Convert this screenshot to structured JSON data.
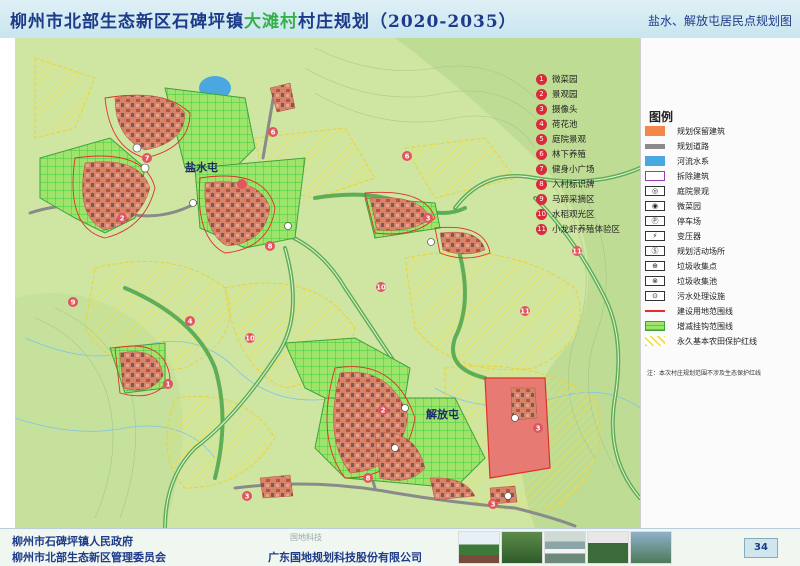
{
  "header": {
    "title_part1": "柳州市北部生态新区石碑坪镇",
    "title_highlight": "大滩村",
    "title_part2": "村庄规划（2020-2035）",
    "subtitle": "盐水、解放屯居民点规划图"
  },
  "map": {
    "north_label": "N",
    "village_labels": {
      "yanshui": "盐水屯",
      "jiefang": "解放屯"
    },
    "zone_markers": [
      "1",
      "2",
      "3",
      "4",
      "5",
      "6",
      "7",
      "8",
      "9",
      "10",
      "11"
    ],
    "numbered_items": [
      {
        "n": "1",
        "label": "微菜园"
      },
      {
        "n": "2",
        "label": "景观园"
      },
      {
        "n": "3",
        "label": "摄像头"
      },
      {
        "n": "4",
        "label": "荷花池"
      },
      {
        "n": "5",
        "label": "庭院景观"
      },
      {
        "n": "6",
        "label": "林下养殖"
      },
      {
        "n": "7",
        "label": "健身小广场"
      },
      {
        "n": "8",
        "label": "入村标识牌"
      },
      {
        "n": "9",
        "label": "马蹄采摘区"
      },
      {
        "n": "10",
        "label": "水稻观光区"
      },
      {
        "n": "11",
        "label": "小龙虾养殖体验区"
      }
    ]
  },
  "legend": {
    "title": "图例",
    "items": [
      {
        "label": "规划保留建筑",
        "icon": "orange-fill",
        "color": "#f2874a"
      },
      {
        "label": "规划道路",
        "icon": "gray-bar",
        "color": "#8a8a8a"
      },
      {
        "label": "河流水系",
        "icon": "blue-fill",
        "color": "#4aa7e0"
      },
      {
        "label": "拆除建筑",
        "icon": "purple-outline",
        "color": "#9b3bb0"
      },
      {
        "label": "庭院景观",
        "icon": "circle-symbol"
      },
      {
        "label": "微菜园",
        "icon": "circle-symbol"
      },
      {
        "label": "停车场",
        "icon": "parking-symbol"
      },
      {
        "label": "变压器",
        "icon": "lightning-symbol"
      },
      {
        "label": "规划活动场所",
        "icon": "activity-symbol"
      },
      {
        "label": "垃圾收集点",
        "icon": "trash-symbol"
      },
      {
        "label": "垃圾收集池",
        "icon": "bin-symbol"
      },
      {
        "label": "污水处理设施",
        "icon": "sewage-symbol"
      },
      {
        "label": "建设用地范围线",
        "icon": "red-line",
        "color": "#e0302a"
      },
      {
        "label": "增减挂钩范围线",
        "icon": "green-grid",
        "color": "#3bd44a"
      },
      {
        "label": "永久基本农田保护红线",
        "icon": "yellow-hatch",
        "color": "#f3e04a"
      }
    ],
    "note": "注：本次村庄规划范围不涉及生态保护红线"
  },
  "footer": {
    "line1": "柳州市石碑坪镇人民政府",
    "line2": "柳州市北部生态新区管理委员会",
    "company": "广东国地规划科技股份有限公司",
    "stamp": "国地科技",
    "page": "34"
  }
}
